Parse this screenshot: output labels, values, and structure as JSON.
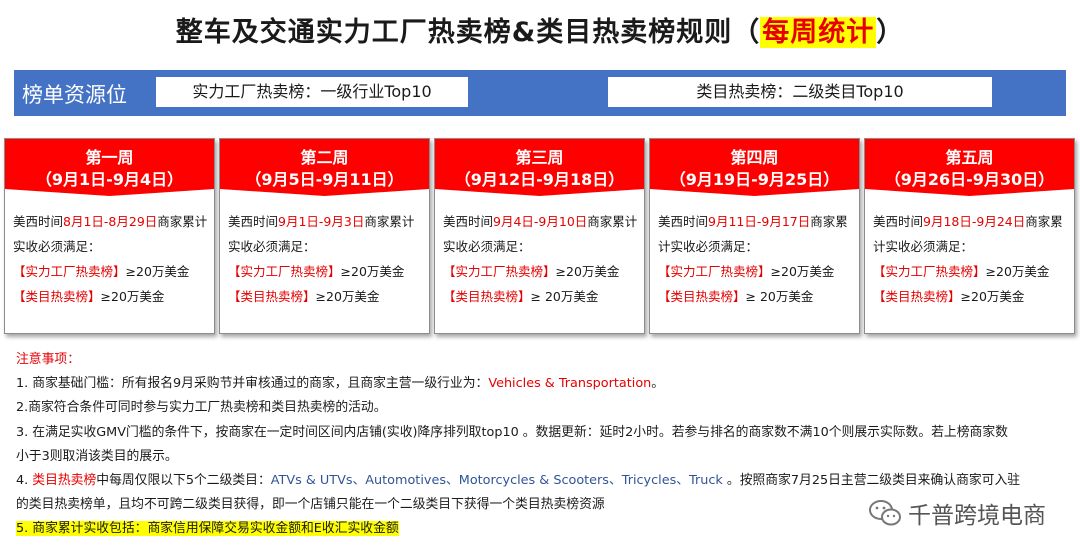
{
  "title": {
    "main": "整车及交通实力工厂热卖榜&类目热卖榜规则（",
    "highlight": "每周统计",
    "end": "）"
  },
  "banner": {
    "label": "榜单资源位",
    "left_box": "实力工厂热卖榜：一级行业Top10",
    "right_box": "类目热卖榜：二级类目Top10"
  },
  "weeks": [
    {
      "name": "第一周",
      "range": "（9月1日-9月4日）",
      "pre": "美西时间",
      "period": "8月1日-8月29日",
      "post": "商家累计实收必须满足：",
      "line1_tag": "【实力工厂热卖榜】",
      "line1_val": "≥20万美金",
      "line2_tag": "【类目热卖榜】",
      "line2_val": "≥20万美金"
    },
    {
      "name": "第二周",
      "range": "（9月5日-9月11日）",
      "pre": "美西时间",
      "period": "9月1日-9月3日",
      "post": "商家累计实收必须满足：",
      "line1_tag": "【实力工厂热卖榜】",
      "line1_val": "≥20万美金",
      "line2_tag": "【类目热卖榜】",
      "line2_val": "≥20万美金"
    },
    {
      "name": "第三周",
      "range": "（9月12日-9月18日）",
      "pre": "美西时间",
      "period": "9月4日-9月10日",
      "post": "商家累计实收必须满足：",
      "line1_tag": "【实力工厂热卖榜】",
      "line1_val": "≥20万美金",
      "line2_tag": "【类目热卖榜】",
      "line2_val": "≥ 20万美金"
    },
    {
      "name": "第四周",
      "range": "（9月19日-9月25日）",
      "pre": "美西时间",
      "period": "9月11日-9月17日",
      "post": "商家累计实收必须满足：",
      "line1_tag": "【实力工厂热卖榜】",
      "line1_val": "≥20万美金",
      "line2_tag": "【类目热卖榜】",
      "line2_val": "≥ 20万美金"
    },
    {
      "name": "第五周",
      "range": "（9月26日-9月30日）",
      "pre": "美西时间",
      "period": "9月18日-9月24日",
      "post": "商家累计实收必须满足：",
      "line1_tag": "【实力工厂热卖榜】",
      "line1_val": "≥20万美金",
      "line2_tag": "【类目热卖榜】",
      "line2_val": "≥20万美金"
    }
  ],
  "notes": {
    "title": "注意事项：",
    "n1_a": "1. 商家基础门槛：所有报名9月采购节并审核通过的商家，且商家主营一级行业为：",
    "n1_b": "Vehicles & Transportation",
    "n1_c": "。",
    "n2": "2.商家符合条件可同时参与实力工厂热卖榜和类目热卖榜的活动。",
    "n3a": "3. 在满足实收GMV门槛的条件下，按商家在一定时间区间内店铺(实收)降序排列取top10 。数据更新：延时2小时。若参与排名的商家数不满10个则展示实际数。若上榜商家数",
    "n3b": "小于3则取消该类目的展示。",
    "n4_a": "4. ",
    "n4_b": "类目热卖榜",
    "n4_c": "中每周仅限以下5个二级类目：",
    "n4_d": "ATVs & UTVs、Automotives、Motorcycles & Scooters、Tricycles、Truck",
    "n4_e": " 。按照商家7月25日主营二级类目来确认商家可入驻",
    "n4_f": "的类目热卖榜单，且均不可跨二级类目获得，即一个店铺只能在一个二级类目下获得一个类目热卖榜资源",
    "n5": "5. 商家累计实收包括：商家信用保障交易实收金额和E收汇实收金额"
  },
  "watermark": {
    "text": "千普跨境电商",
    "icon": "wechat-icon"
  },
  "colors": {
    "red": "#e60000",
    "banner_blue": "#4472c4",
    "highlight_yellow": "#ffff00",
    "card_head_red": "#ff0000"
  }
}
